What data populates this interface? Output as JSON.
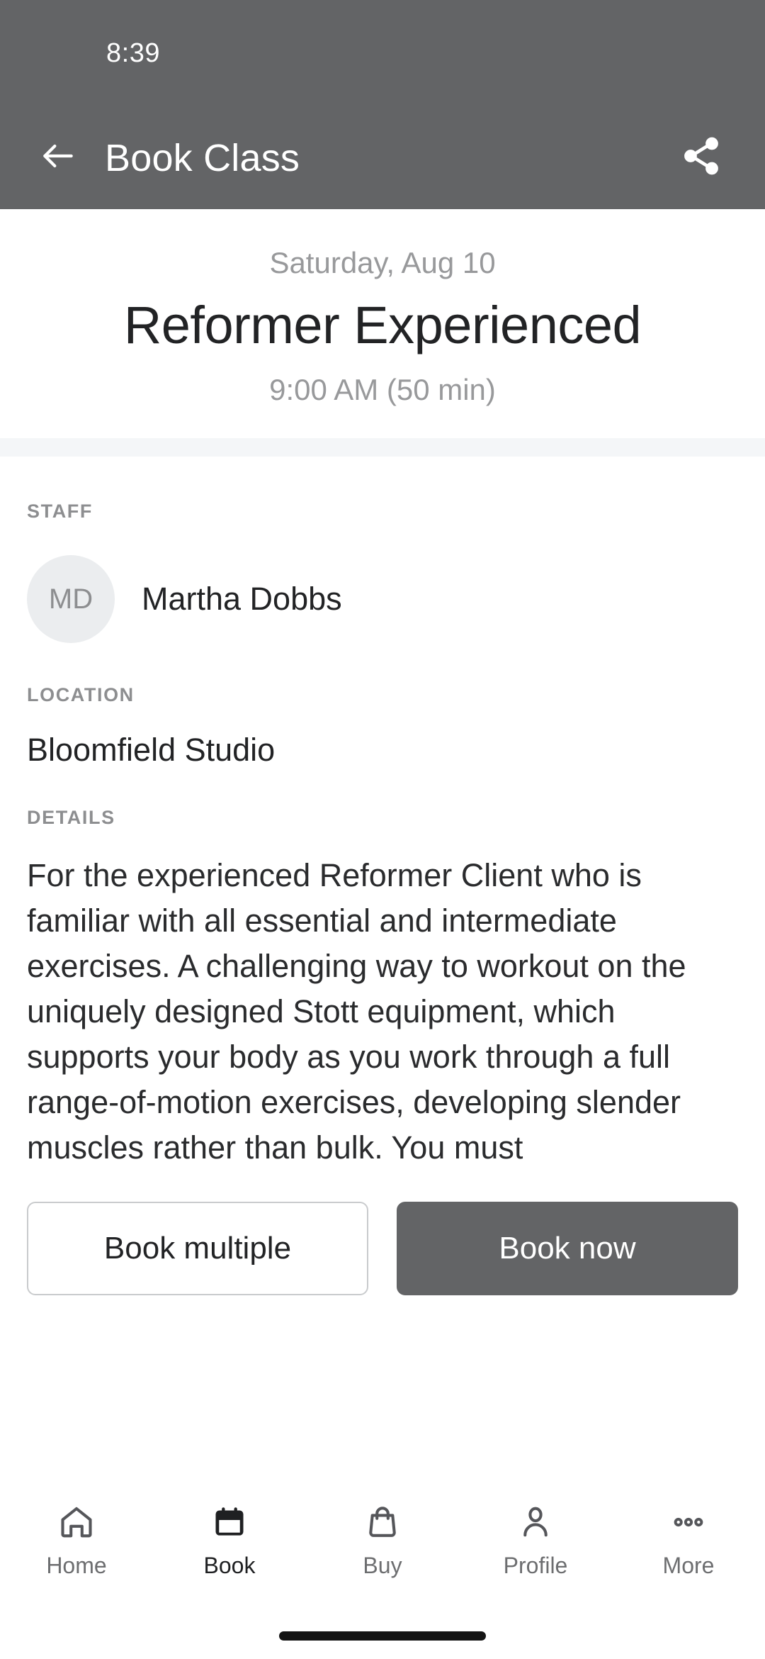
{
  "status_bar": {
    "clock": "8:39"
  },
  "app_bar": {
    "back_icon": "arrow-left-icon",
    "title": "Book Class",
    "share_icon": "share-icon"
  },
  "hero": {
    "date": "Saturday, Aug 10",
    "class_name": "Reformer Experienced",
    "time": "9:00 AM (50 min)"
  },
  "staff": {
    "label": "STAFF",
    "avatar_initials": "MD",
    "name": "Martha Dobbs"
  },
  "location": {
    "label": "LOCATION",
    "value": "Bloomfield Studio"
  },
  "details": {
    "label": "DETAILS",
    "body": "For the experienced Reformer Client who is familiar with all essential and intermediate exercises. A challenging way to workout on the uniquely designed Stott equipment, which supports your body as you work through a full range-of-motion exercises, developing slender muscles rather than bulk. You must"
  },
  "actions": {
    "book_multiple_label": "Book multiple",
    "book_now_label": "Book now"
  },
  "bottom_nav": {
    "items": [
      {
        "label": "Home",
        "icon": "home-icon",
        "active": false
      },
      {
        "label": "Book",
        "icon": "calendar-icon",
        "active": true
      },
      {
        "label": "Buy",
        "icon": "bag-icon",
        "active": false
      },
      {
        "label": "Profile",
        "icon": "person-icon",
        "active": false
      },
      {
        "label": "More",
        "icon": "dots-icon",
        "active": false
      }
    ]
  },
  "colors": {
    "app_bar_bg": "#636466",
    "primary_button": "#636466",
    "muted_text": "#98999b",
    "body_text": "#222325",
    "divider_band": "#f4f6f8"
  }
}
